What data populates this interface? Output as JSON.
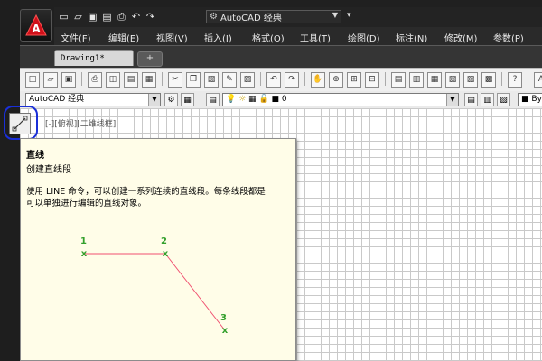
{
  "app": {
    "logo_letter": "A"
  },
  "title_bar": {
    "workspace_selected": "AutoCAD 经典",
    "quick_access_icons": [
      "new-icon",
      "open-icon",
      "save-icon",
      "saveas-icon",
      "print-icon",
      "undo-icon",
      "redo-icon"
    ]
  },
  "menu": {
    "items": [
      {
        "label": "文件(F)"
      },
      {
        "label": "编辑(E)"
      },
      {
        "label": "视图(V)"
      },
      {
        "label": "插入(I)"
      },
      {
        "label": "格式(O)"
      },
      {
        "label": "工具(T)"
      },
      {
        "label": "绘图(D)"
      },
      {
        "label": "标注(N)"
      },
      {
        "label": "修改(M)"
      },
      {
        "label": "参数(P)"
      }
    ]
  },
  "tabs": {
    "active": "Drawing1*"
  },
  "toolbar2": {
    "workspace_selected": "AutoCAD 经典",
    "layer_selected": "0",
    "color_selected": "By"
  },
  "viewport": {
    "label": "[-][俯视][二维线框]"
  },
  "tooltip": {
    "title": "直线",
    "subtitle": "创建直线段",
    "description": "使用 LINE 命令，可以创建一系列连续的直线段。每条线段都是\n可以单独进行编辑的直线对象。",
    "points": [
      {
        "label": "1"
      },
      {
        "label": "2"
      },
      {
        "label": "3"
      }
    ],
    "colors": {
      "point_marker": "#33a02c",
      "line": "#f05070"
    }
  }
}
